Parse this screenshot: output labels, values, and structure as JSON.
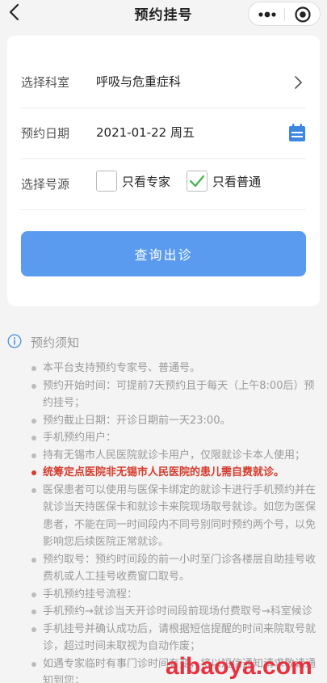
{
  "header": {
    "title": "预约挂号",
    "back_icon": "chevron-left-icon",
    "more_icon": "more-icon",
    "close_icon": "close-miniprogram-icon"
  },
  "form": {
    "department": {
      "label": "选择科室",
      "value": "呼吸与危重症科"
    },
    "date": {
      "label": "预约日期",
      "value": "2021-01-22 周五"
    },
    "source": {
      "label": "选择号源",
      "options": [
        {
          "label": "只看专家",
          "checked": false
        },
        {
          "label": "只看普通",
          "checked": true
        }
      ]
    },
    "query_button": "查询出诊"
  },
  "notice": {
    "title": "预约须知",
    "items": [
      {
        "text": "本平台支持预约专家号、普通号。",
        "highlight": false
      },
      {
        "text": "预约开始时间：可提前7天预约且于每天（上午8:00后）预约挂号；",
        "highlight": false
      },
      {
        "text": "预约截止日期：开诊日期前一天23:00。",
        "highlight": false
      },
      {
        "text": "手机预约用户：",
        "highlight": false
      },
      {
        "text": "持有无锡市人民医院就诊卡用户，仅限就诊卡本人使用；",
        "highlight": false
      },
      {
        "text": "统筹定点医院非无锡市人民医院的患儿需自费就诊。",
        "highlight": true
      },
      {
        "text": "医保患者可以使用与医保卡绑定的就诊卡进行手机预约并在就诊当天持医保卡和就诊卡来院现场取号就诊。如您为医保患者，不能在同一时间段内不同号别同时预约两个号，以免影响您后续医院正常就诊。",
        "highlight": false
      },
      {
        "text": "预约取号：预约时间段的前一小时至门诊各楼层自助挂号收费机或人工挂号收费窗口取号。",
        "highlight": false
      },
      {
        "text": "手机预约挂号流程：",
        "highlight": false
      },
      {
        "text": "手机预约→就诊当天开诊时间段前现场付费取号→科室候诊",
        "highlight": false
      },
      {
        "text": "手机挂号并确认成功后，请根据短信提醒的时间来院取号就诊，超过时间未取视为自动作废；",
        "highlight": false
      },
      {
        "text": "如遇专家临时有事门诊时间有变，将以短信通知请求敬请通知到您；",
        "highlight": false
      }
    ]
  },
  "watermark": "aibaoya.com",
  "colors": {
    "accent": "#5a9bf0",
    "warning": "#d63a2b",
    "check": "#3cb54a",
    "watermark": "#e8303f"
  }
}
